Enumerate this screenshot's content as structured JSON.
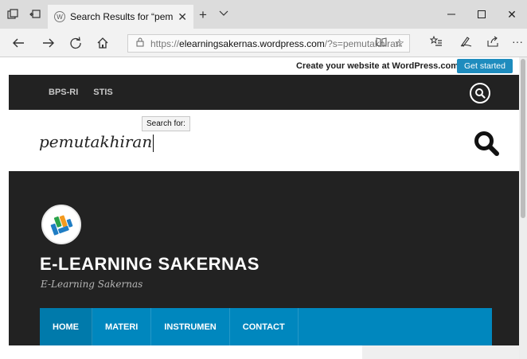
{
  "browser": {
    "tab_title": "Search Results for “pem",
    "url_scheme": "https://",
    "url_domain": "elearningsakernas.wordpress.com",
    "url_query": "/?s=pemutakhiran"
  },
  "wordpress_bar": {
    "text": "Create your website at WordPress.com",
    "button": "Get started"
  },
  "topnav": [
    "BPS-RI",
    "STIS"
  ],
  "search": {
    "value": "pemutakhiran",
    "tooltip": "Search for:"
  },
  "site": {
    "title": "E-LEARNING SAKERNAS",
    "description": "E-Learning Sakernas"
  },
  "menu": [
    "HOME",
    "MATERI",
    "INSTRUMEN",
    "CONTACT"
  ],
  "colors": {
    "header_bg": "#222222",
    "menu_bg": "#0087be",
    "wp_button": "#1e8cbe"
  }
}
